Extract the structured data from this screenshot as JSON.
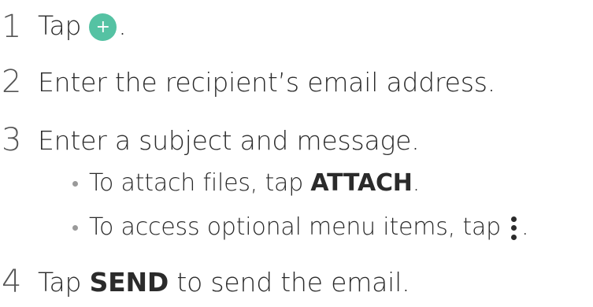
{
  "steps": [
    {
      "num": "1",
      "text_before": "Tap",
      "text_after": "."
    },
    {
      "num": "2",
      "text": "Enter the recipient’s email address."
    },
    {
      "num": "3",
      "text": "Enter a subject and message."
    },
    {
      "num": "4",
      "text_before": "Tap ",
      "bold": "SEND",
      "text_after": " to send the email."
    }
  ],
  "bullets": [
    {
      "text_before": "To attach files, tap ",
      "bold": "ATTACH",
      "text_after": "."
    },
    {
      "text_before": "To access optional menu items, tap",
      "text_after": "."
    }
  ],
  "icons": {
    "plus": "+",
    "plus_color": "#55c2a3",
    "more": "more-vertical-icon"
  }
}
